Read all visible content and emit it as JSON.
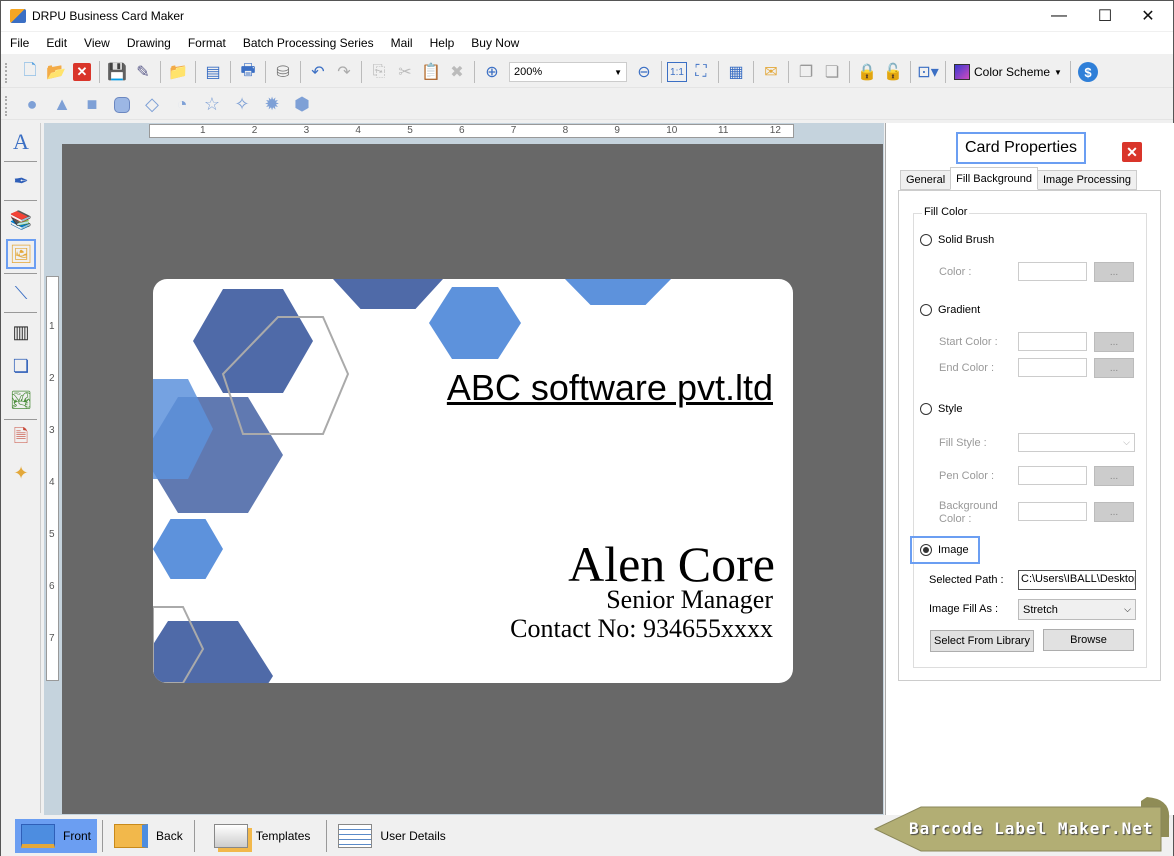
{
  "window": {
    "title": "DRPU Business Card Maker",
    "minimize": "—",
    "maximize": "☐",
    "close": "✕"
  },
  "menu": [
    "File",
    "Edit",
    "View",
    "Drawing",
    "Format",
    "Batch Processing Series",
    "Mail",
    "Help",
    "Buy Now"
  ],
  "toolbar": {
    "zoom_value": "200%",
    "color_scheme_label": "Color Scheme",
    "icons": [
      "new-icon",
      "open-icon",
      "close-file-icon",
      "save-icon",
      "save-as-icon",
      "open-folder-icon",
      "page-setup-icon",
      "print-icon",
      "database-icon",
      "undo-icon",
      "redo-icon",
      "copy-icon",
      "cut-icon",
      "paste-icon",
      "delete-icon",
      "zoom-in-icon",
      "zoom-out-icon",
      "actual-size-icon",
      "fit-window-icon",
      "grid-icon",
      "email-icon",
      "bring-front-icon",
      "send-back-icon",
      "lock-icon",
      "unlock-icon",
      "align-icon",
      "color-scheme-icon",
      "buy-icon"
    ]
  },
  "shapes": [
    "circle",
    "triangle",
    "rectangle",
    "rounded-rectangle",
    "diamond",
    "arc",
    "star",
    "four-point-star",
    "burst",
    "polygon"
  ],
  "left_tools": [
    "text-tool",
    "signature-tool",
    "library-tool",
    "image-tool",
    "line-tool",
    "barcode-tool",
    "watermark-tool",
    "picture-tool",
    "word-art-tool",
    "symbol-tool"
  ],
  "rulers": {
    "horizontal": [
      "1",
      "2",
      "3",
      "4",
      "5",
      "6",
      "7",
      "8",
      "9",
      "10",
      "11",
      "12"
    ],
    "vertical": [
      "1",
      "2",
      "3",
      "4",
      "5",
      "6",
      "7"
    ]
  },
  "card": {
    "company": "ABC software pvt.ltd",
    "name": "Alen Core",
    "role": "Senior Manager",
    "contact": "Contact No: 934655xxxx"
  },
  "properties": {
    "title": "Card Properties",
    "tabs": [
      "General",
      "Fill Background",
      "Image Processing"
    ],
    "active_tab": "Fill Background",
    "group_label": "Fill Color",
    "solid_brush": "Solid Brush",
    "color_label": "Color :",
    "gradient": "Gradient",
    "start_color_label": "Start Color :",
    "end_color_label": "End Color :",
    "style": "Style",
    "fill_style_label": "Fill Style :",
    "pen_color_label": "Pen Color :",
    "background_color_label": "Background Color :",
    "image": "Image",
    "selected_path_label": "Selected Path :",
    "selected_path_value": "C:\\Users\\IBALL\\Desktop",
    "image_fill_label": "Image Fill As :",
    "image_fill_value": "Stretch",
    "select_library_btn": "Select From Library",
    "browse_btn": "Browse",
    "dots": "...",
    "selected_fill": "Image"
  },
  "bottom_tabs": [
    "Front",
    "Back",
    "Templates",
    "User Details"
  ],
  "active_bottom_tab": "Front",
  "banner_text": "Barcode Label Maker.Net",
  "colors": {
    "accent": "#6b9ef2",
    "canvas": "#686868",
    "hex_dark": "#4f6aa8",
    "hex_light": "#5d92dc"
  }
}
